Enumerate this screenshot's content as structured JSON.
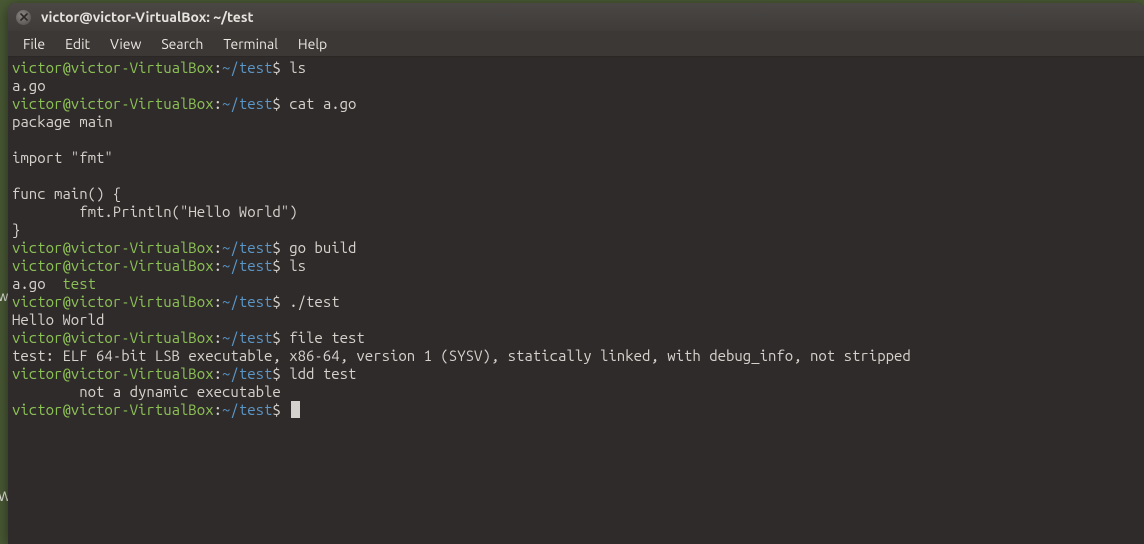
{
  "window": {
    "title": "victor@victor-VirtualBox: ~/test"
  },
  "menubar": [
    "File",
    "Edit",
    "View",
    "Search",
    "Terminal",
    "Help"
  ],
  "prompt": {
    "user_host": "victor@victor-VirtualBox",
    "sep": ":",
    "path": "~/test",
    "dollar": "$"
  },
  "left_strip_chars": {
    "top": "w",
    "bottom": "W"
  },
  "lines": [
    {
      "type": "prompt",
      "cmd": "ls"
    },
    {
      "type": "output",
      "text": "a.go"
    },
    {
      "type": "prompt",
      "cmd": "cat a.go"
    },
    {
      "type": "output",
      "text": "package main"
    },
    {
      "type": "output",
      "text": ""
    },
    {
      "type": "output",
      "text": "import \"fmt\""
    },
    {
      "type": "output",
      "text": ""
    },
    {
      "type": "output",
      "text": "func main() {"
    },
    {
      "type": "output",
      "text": "        fmt.Println(\"Hello World\")"
    },
    {
      "type": "output",
      "text": "}"
    },
    {
      "type": "prompt",
      "cmd": "go build"
    },
    {
      "type": "prompt",
      "cmd": "ls"
    },
    {
      "type": "ls-output",
      "segments": [
        {
          "text": "a.go  ",
          "cls": "seg-out"
        },
        {
          "text": "test",
          "cls": "seg-exe"
        }
      ]
    },
    {
      "type": "prompt",
      "cmd": "./test"
    },
    {
      "type": "output",
      "text": "Hello World"
    },
    {
      "type": "prompt",
      "cmd": "file test"
    },
    {
      "type": "output",
      "text": "test: ELF 64-bit LSB executable, x86-64, version 1 (SYSV), statically linked, with debug_info, not stripped"
    },
    {
      "type": "prompt",
      "cmd": "ldd test"
    },
    {
      "type": "output",
      "text": "        not a dynamic executable"
    },
    {
      "type": "prompt-cursor",
      "cmd": ""
    }
  ]
}
